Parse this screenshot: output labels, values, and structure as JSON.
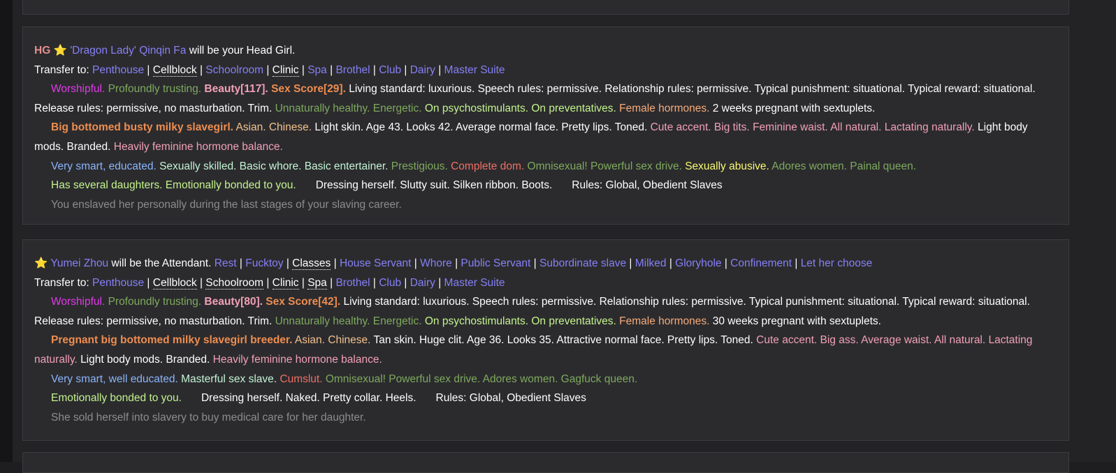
{
  "slave1": {
    "hg_tag": "HG",
    "star": "⭐",
    "nickname": "'Dragon Lady'",
    "name": "Qinqin Fa",
    "role_text": "will be your Head Girl.",
    "transfer_label": "Transfer to:",
    "transfer": [
      "Penthouse",
      "Cellblock",
      "Schoolroom",
      "Clinic",
      "Spa",
      "Brothel",
      "Club",
      "Dairy",
      "Master Suite"
    ],
    "devotion": "Worshipful.",
    "trust": "Profoundly trusting.",
    "beauty": "Beauty[117].",
    "sex_score": "Sex Score[29].",
    "rules_text": "Living standard: luxurious. Speech rules: permissive. Relationship rules: permissive. Typical punishment: situational. Typical reward: situational. Release rules: permissive, no masturbation. Trim.",
    "health": "Unnaturally healthy.",
    "energy": "Energetic.",
    "drugs": "On psychostimulants.",
    "preventatives": "On preventatives.",
    "hormones": "Female hormones.",
    "pregnancy": "2 weeks pregnant with sextuplets.",
    "title": "Big bottomed busty milky slavegirl.",
    "race": "Asian.",
    "nationality": "Chinese.",
    "desc1": "Light skin. Age 43. Looks 42. Average normal face. Pretty lips. Toned.",
    "accent": "Cute accent.",
    "tits": "Big tits.",
    "waist": "Feminine waist.",
    "natural": "All natural.",
    "lactation": "Lactating naturally.",
    "desc2": "Light body mods. Branded.",
    "hormone_balance": "Heavily feminine hormone balance.",
    "intelligence": "Very smart, educated.",
    "skills": "Sexually skilled. Basic whore. Basic entertainer.",
    "prestige": "Prestigious.",
    "dom": "Complete dom.",
    "orientation": "Omnisexual! Powerful sex drive.",
    "flaw": "Sexually abusive.",
    "fetish": "Adores women. Painal queen.",
    "family": "Has several daughters. Emotionally bonded to you.",
    "clothing": "Dressing herself. Slutty suit. Silken ribbon. Boots.",
    "rules": "Rules: Global, Obedient Slaves",
    "origin": "You enslaved her personally during the last stages of your slaving career."
  },
  "slave2": {
    "star": "⭐",
    "name": "Yumei Zhou",
    "role_text": "will be the Attendant.",
    "assignments": [
      "Rest",
      "Fucktoy",
      "Classes",
      "House Servant",
      "Whore",
      "Public Servant",
      "Subordinate slave",
      "Milked",
      "Gloryhole",
      "Confinement",
      "Let her choose"
    ],
    "transfer_label": "Transfer to:",
    "transfer": [
      "Penthouse",
      "Cellblock",
      "Schoolroom",
      "Clinic",
      "Spa",
      "Brothel",
      "Club",
      "Dairy",
      "Master Suite"
    ],
    "devotion": "Worshipful.",
    "trust": "Profoundly trusting.",
    "beauty": "Beauty[80].",
    "sex_score": "Sex Score[42].",
    "rules_text": "Living standard: luxurious. Speech rules: permissive. Relationship rules: permissive. Typical punishment: situational. Typical reward: situational. Release rules: permissive, no masturbation. Trim.",
    "health": "Unnaturally healthy.",
    "energy": "Energetic.",
    "drugs": "On psychostimulants.",
    "preventatives": "On preventatives.",
    "hormones": "Female hormones.",
    "pregnancy": "30 weeks pregnant with sextuplets.",
    "title": "Pregnant big bottomed milky slavegirl breeder.",
    "race": "Asian.",
    "nationality": "Chinese.",
    "desc1": "Tan skin. Huge clit. Age 36. Looks 35. Attractive normal face. Pretty lips. Toned.",
    "accent": "Cute accent.",
    "ass": "Big ass.",
    "waist": "Average waist.",
    "natural": "All natural.",
    "lactation": "Lactating naturally.",
    "desc2": "Light body mods. Branded.",
    "hormone_balance": "Heavily feminine hormone balance.",
    "intelligence": "Very smart, well educated.",
    "skills": "Masterful sex slave.",
    "flaw": "Cumslut.",
    "orientation": "Omnisexual! Powerful sex drive. Adores women. Gagfuck queen.",
    "family": "Emotionally bonded to you.",
    "clothing": "Dressing herself. Naked. Pretty collar. Heels.",
    "rules": "Rules: Global, Obedient Slaves",
    "origin": "She sold herself into slavery to buy medical care for her daughter."
  }
}
